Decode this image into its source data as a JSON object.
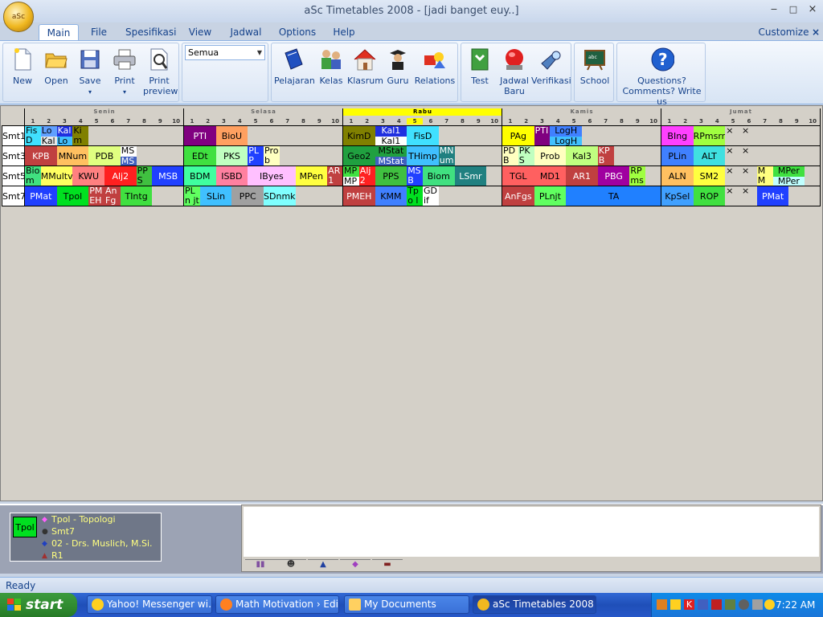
{
  "window": {
    "title": "aSc Timetables 2008  - [jadi banget euy..]",
    "orb_label": "aSc",
    "minimize": "−",
    "maximize": "□",
    "close": "×",
    "customize": "Customize ▾",
    "customize_close": "×"
  },
  "menu_tabs": [
    "Main",
    "File",
    "Spesifikasi",
    "View",
    "Jadwal",
    "Options",
    "Help"
  ],
  "ribbon": {
    "file_buttons": [
      {
        "label": "New",
        "icon": "new-document-icon"
      },
      {
        "label": "Open",
        "icon": "folder-open-icon"
      },
      {
        "label": "Save",
        "icon": "floppy-disk-icon",
        "dropdown": "▾"
      },
      {
        "label": "Print",
        "icon": "printer-icon",
        "dropdown": "▾"
      },
      {
        "label": "Print preview",
        "icon": "print-preview-icon"
      }
    ],
    "filter_select": "Semua",
    "data_buttons": [
      {
        "label": "Pelajaran",
        "icon": "book-icon"
      },
      {
        "label": "Kelas",
        "icon": "students-icon"
      },
      {
        "label": "Klasrum",
        "icon": "house-icon"
      },
      {
        "label": "Guru",
        "icon": "teacher-icon"
      },
      {
        "label": "Relations",
        "icon": "shapes-icon"
      }
    ],
    "gen_buttons": [
      {
        "label": "Test",
        "icon": "test-icon"
      },
      {
        "label": "Jadwal Baru",
        "icon": "generate-icon"
      },
      {
        "label": "Verifikasi",
        "icon": "flashlight-icon"
      }
    ],
    "school_button": {
      "label": "School",
      "icon": "blackboard-icon"
    },
    "help_button": {
      "label": "Questions? Comments? Write us",
      "icon": "question-icon"
    }
  },
  "timetable": {
    "days": [
      "Senin",
      "Selasa",
      "Rabu",
      "Kamis",
      "Jumat"
    ],
    "today": "Rabu",
    "today_period": "5",
    "periods": [
      "1",
      "2",
      "3",
      "4",
      "5",
      "6",
      "7",
      "8",
      "9",
      "10"
    ],
    "rows": [
      "Smt1",
      "Smt3",
      "Smt5",
      "Smt7"
    ],
    "cells": [
      {
        "r": 0,
        "d": 0,
        "p": 0,
        "w": 1,
        "h": 2,
        "t": "Fis D",
        "c": "#40e0ff"
      },
      {
        "r": 0,
        "d": 0,
        "p": 1,
        "w": 1,
        "h": 1,
        "t": "Log",
        "c": "#60a0ff"
      },
      {
        "r": 0,
        "d": 0,
        "p": 1,
        "w": 1,
        "h": 1,
        "o": 1,
        "t": "Kal",
        "c": "#e8e8e8"
      },
      {
        "r": 0,
        "d": 0,
        "p": 2,
        "w": 1,
        "h": 1,
        "t": "Kal",
        "c": "#2030e0"
      },
      {
        "r": 0,
        "d": 0,
        "p": 2,
        "w": 1,
        "h": 1,
        "o": 1,
        "t": "Log",
        "c": "#40c0ff"
      },
      {
        "r": 0,
        "d": 0,
        "p": 3,
        "w": 1,
        "h": 2,
        "t": "Kim D",
        "c": "#808000"
      },
      {
        "r": 0,
        "d": 1,
        "p": 0,
        "w": 2,
        "h": 2,
        "t": "PTI",
        "c": "#800080"
      },
      {
        "r": 0,
        "d": 1,
        "p": 2,
        "w": 2,
        "h": 2,
        "t": "BioU",
        "c": "#ffa060"
      },
      {
        "r": 0,
        "d": 2,
        "p": 0,
        "w": 2,
        "h": 2,
        "t": "KimD",
        "c": "#808000"
      },
      {
        "r": 0,
        "d": 2,
        "p": 2,
        "w": 2,
        "h": 1,
        "t": "Kal1",
        "c": "#2030e0"
      },
      {
        "r": 0,
        "d": 2,
        "p": 2,
        "w": 2,
        "h": 1,
        "o": 1,
        "t": "Kal1",
        "c": "#ffffff"
      },
      {
        "r": 0,
        "d": 2,
        "p": 4,
        "w": 2,
        "h": 2,
        "t": "FisD",
        "c": "#40e0ff"
      },
      {
        "r": 0,
        "d": 3,
        "p": 0,
        "w": 2,
        "h": 2,
        "t": "PAg",
        "c": "#ffff00"
      },
      {
        "r": 0,
        "d": 3,
        "p": 2,
        "w": 1,
        "h": 2,
        "t": "PTI",
        "c": "#800080"
      },
      {
        "r": 0,
        "d": 3,
        "p": 3,
        "w": 2,
        "h": 1,
        "t": "LogH",
        "c": "#4080ff"
      },
      {
        "r": 0,
        "d": 3,
        "p": 3,
        "w": 2,
        "h": 1,
        "o": 1,
        "t": "LogH",
        "c": "#40c0ff"
      },
      {
        "r": 0,
        "d": 4,
        "p": 0,
        "w": 2,
        "h": 2,
        "t": "BIng",
        "c": "#ff40ff"
      },
      {
        "r": 0,
        "d": 4,
        "p": 2,
        "w": 2,
        "h": 2,
        "t": "RPmsrn",
        "c": "#a0ff40"
      },
      {
        "r": 0,
        "d": 4,
        "p": 4,
        "w": 1,
        "h": 2,
        "t": "×",
        "c": "#d4d0c8"
      },
      {
        "r": 0,
        "d": 4,
        "p": 5,
        "w": 1,
        "h": 2,
        "t": "×",
        "c": "#d4d0c8"
      },
      {
        "r": 1,
        "d": 0,
        "p": 0,
        "w": 2,
        "h": 2,
        "t": "KPB",
        "c": "#c04040"
      },
      {
        "r": 1,
        "d": 0,
        "p": 2,
        "w": 2,
        "h": 2,
        "t": "MNum",
        "c": "#ffc060"
      },
      {
        "r": 1,
        "d": 0,
        "p": 4,
        "w": 2,
        "h": 2,
        "t": "PDB",
        "c": "#e0ff80"
      },
      {
        "r": 1,
        "d": 0,
        "p": 6,
        "w": 1,
        "h": 1,
        "t": "MSt",
        "c": "#ffffff"
      },
      {
        "r": 1,
        "d": 0,
        "p": 6,
        "w": 1,
        "h": 1,
        "o": 1,
        "t": "MSt",
        "c": "#4060c0"
      },
      {
        "r": 1,
        "d": 1,
        "p": 0,
        "w": 2,
        "h": 2,
        "t": "EDt",
        "c": "#40e040"
      },
      {
        "r": 1,
        "d": 1,
        "p": 2,
        "w": 2,
        "h": 2,
        "t": "PKS",
        "c": "#c0ffc0"
      },
      {
        "r": 1,
        "d": 1,
        "p": 4,
        "w": 1,
        "h": 2,
        "t": "PL P",
        "c": "#2040ff"
      },
      {
        "r": 1,
        "d": 1,
        "p": 5,
        "w": 1,
        "h": 2,
        "t": "Pro b",
        "c": "#ffffc0"
      },
      {
        "r": 1,
        "d": 2,
        "p": 0,
        "w": 2,
        "h": 2,
        "t": "Geo2",
        "c": "#20a040"
      },
      {
        "r": 1,
        "d": 2,
        "p": 2,
        "w": 2,
        "h": 1,
        "t": "MStat",
        "c": "#20a040"
      },
      {
        "r": 1,
        "d": 2,
        "p": 2,
        "w": 2,
        "h": 1,
        "o": 1,
        "t": "MStat",
        "c": "#4060c0"
      },
      {
        "r": 1,
        "d": 2,
        "p": 4,
        "w": 2,
        "h": 2,
        "t": "THimp",
        "c": "#40c0ff"
      },
      {
        "r": 1,
        "d": 2,
        "p": 6,
        "w": 1,
        "h": 2,
        "t": "MN um",
        "c": "#208080"
      },
      {
        "r": 1,
        "d": 3,
        "p": 0,
        "w": 1,
        "h": 2,
        "t": "PD B",
        "c": "#ffffc0"
      },
      {
        "r": 1,
        "d": 3,
        "p": 1,
        "w": 1,
        "h": 2,
        "t": "PK S",
        "c": "#c0ffc0"
      },
      {
        "r": 1,
        "d": 3,
        "p": 2,
        "w": 2,
        "h": 2,
        "t": "Prob",
        "c": "#ffffc0"
      },
      {
        "r": 1,
        "d": 3,
        "p": 4,
        "w": 2,
        "h": 2,
        "t": "Kal3",
        "c": "#c0ff80"
      },
      {
        "r": 1,
        "d": 3,
        "p": 6,
        "w": 1,
        "h": 2,
        "t": "KP B",
        "c": "#c04040"
      },
      {
        "r": 1,
        "d": 4,
        "p": 0,
        "w": 2,
        "h": 2,
        "t": "PLin",
        "c": "#4080ff"
      },
      {
        "r": 1,
        "d": 4,
        "p": 2,
        "w": 2,
        "h": 2,
        "t": "ALT",
        "c": "#40e0e0"
      },
      {
        "r": 1,
        "d": 4,
        "p": 4,
        "w": 1,
        "h": 2,
        "t": "×",
        "c": "#d4d0c8"
      },
      {
        "r": 1,
        "d": 4,
        "p": 5,
        "w": 1,
        "h": 2,
        "t": "×",
        "c": "#d4d0c8"
      },
      {
        "r": 2,
        "d": 0,
        "p": 0,
        "w": 1,
        "h": 2,
        "t": "Bio m",
        "c": "#40e080"
      },
      {
        "r": 2,
        "d": 0,
        "p": 1,
        "w": 2,
        "h": 2,
        "t": "MMultv",
        "c": "#ffff60"
      },
      {
        "r": 2,
        "d": 0,
        "p": 3,
        "w": 2,
        "h": 2,
        "t": "KWU",
        "c": "#ff8080"
      },
      {
        "r": 2,
        "d": 0,
        "p": 5,
        "w": 2,
        "h": 2,
        "t": "Alj2",
        "c": "#ff2020"
      },
      {
        "r": 2,
        "d": 0,
        "p": 7,
        "w": 1,
        "h": 2,
        "t": "PPS",
        "c": "#40c040"
      },
      {
        "r": 2,
        "d": 0,
        "p": 8,
        "w": 2,
        "h": 2,
        "t": "MSB",
        "c": "#2040ff"
      },
      {
        "r": 2,
        "d": 1,
        "p": 0,
        "w": 2,
        "h": 2,
        "t": "BDM",
        "c": "#40ffa0"
      },
      {
        "r": 2,
        "d": 1,
        "p": 2,
        "w": 2,
        "h": 2,
        "t": "ISBD",
        "c": "#ff80a0"
      },
      {
        "r": 2,
        "d": 1,
        "p": 4,
        "w": 3,
        "h": 2,
        "t": "IByes",
        "c": "#ffc0ff"
      },
      {
        "r": 2,
        "d": 1,
        "p": 7,
        "w": 2,
        "h": 2,
        "t": "MPen",
        "c": "#ffff40"
      },
      {
        "r": 2,
        "d": 1,
        "p": 9,
        "w": 1,
        "h": 2,
        "t": "AR 1",
        "c": "#c04040"
      },
      {
        "r": 2,
        "d": 2,
        "p": 0,
        "w": 1,
        "h": 1,
        "t": "MP",
        "c": "#40e040"
      },
      {
        "r": 2,
        "d": 2,
        "p": 0,
        "w": 1,
        "h": 1,
        "o": 1,
        "t": "MP",
        "c": "#ffffff"
      },
      {
        "r": 2,
        "d": 2,
        "p": 1,
        "w": 1,
        "h": 2,
        "t": "Alj2",
        "c": "#ff2020"
      },
      {
        "r": 2,
        "d": 2,
        "p": 2,
        "w": 2,
        "h": 2,
        "t": "PPS",
        "c": "#40c040"
      },
      {
        "r": 2,
        "d": 2,
        "p": 4,
        "w": 1,
        "h": 2,
        "t": "MS B",
        "c": "#2040ff"
      },
      {
        "r": 2,
        "d": 2,
        "p": 5,
        "w": 2,
        "h": 2,
        "t": "Biom",
        "c": "#40e080"
      },
      {
        "r": 2,
        "d": 2,
        "p": 7,
        "w": 2,
        "h": 2,
        "t": "LSmr",
        "c": "#208080"
      },
      {
        "r": 2,
        "d": 3,
        "p": 0,
        "w": 2,
        "h": 2,
        "t": "TGL",
        "c": "#ff6060"
      },
      {
        "r": 2,
        "d": 3,
        "p": 2,
        "w": 2,
        "h": 2,
        "t": "MD1",
        "c": "#ff6060"
      },
      {
        "r": 2,
        "d": 3,
        "p": 4,
        "w": 2,
        "h": 2,
        "t": "AR1",
        "c": "#c04040"
      },
      {
        "r": 2,
        "d": 3,
        "p": 6,
        "w": 2,
        "h": 2,
        "t": "PBG",
        "c": "#a000a0"
      },
      {
        "r": 2,
        "d": 3,
        "p": 8,
        "w": 1,
        "h": 2,
        "t": "RP msr",
        "c": "#a0ff40"
      },
      {
        "r": 2,
        "d": 4,
        "p": 0,
        "w": 2,
        "h": 2,
        "t": "ALN",
        "c": "#ffc060"
      },
      {
        "r": 2,
        "d": 4,
        "p": 2,
        "w": 2,
        "h": 2,
        "t": "SM2",
        "c": "#ffff40"
      },
      {
        "r": 2,
        "d": 4,
        "p": 4,
        "w": 1,
        "h": 2,
        "t": "×",
        "c": "#d4d0c8"
      },
      {
        "r": 2,
        "d": 4,
        "p": 5,
        "w": 1,
        "h": 2,
        "t": "×",
        "c": "#d4d0c8"
      },
      {
        "r": 2,
        "d": 4,
        "p": 6,
        "w": 1,
        "h": 2,
        "t": "MM ultv",
        "c": "#ffff80"
      },
      {
        "r": 2,
        "d": 4,
        "p": 7,
        "w": 2,
        "h": 1,
        "t": "MPer",
        "c": "#40e040"
      },
      {
        "r": 2,
        "d": 4,
        "p": 7,
        "w": 2,
        "h": 1,
        "o": 1,
        "t": "MPer",
        "c": "#c0ffff"
      },
      {
        "r": 3,
        "d": 0,
        "p": 0,
        "w": 2,
        "h": 2,
        "t": "PMat",
        "c": "#2040ff"
      },
      {
        "r": 3,
        "d": 0,
        "p": 2,
        "w": 2,
        "h": 2,
        "t": "Tpol",
        "c": "#00e020"
      },
      {
        "r": 3,
        "d": 0,
        "p": 4,
        "w": 1,
        "h": 2,
        "t": "PM EH",
        "c": "#c04040"
      },
      {
        "r": 3,
        "d": 0,
        "p": 5,
        "w": 1,
        "h": 2,
        "t": "AnFgs",
        "c": "#c04040"
      },
      {
        "r": 3,
        "d": 0,
        "p": 6,
        "w": 2,
        "h": 2,
        "t": "TIntg",
        "c": "#40e040"
      },
      {
        "r": 3,
        "d": 1,
        "p": 0,
        "w": 1,
        "h": 2,
        "t": "PLn jt",
        "c": "#60ff60"
      },
      {
        "r": 3,
        "d": 1,
        "p": 1,
        "w": 2,
        "h": 2,
        "t": "SLin",
        "c": "#40c0ff"
      },
      {
        "r": 3,
        "d": 1,
        "p": 3,
        "w": 2,
        "h": 2,
        "t": "PPC",
        "c": "#a0a0a0"
      },
      {
        "r": 3,
        "d": 1,
        "p": 5,
        "w": 2,
        "h": 2,
        "t": "SDnmk",
        "c": "#80ffff"
      },
      {
        "r": 3,
        "d": 2,
        "p": 0,
        "w": 2,
        "h": 2,
        "t": "PMEH",
        "c": "#c04040"
      },
      {
        "r": 3,
        "d": 2,
        "p": 2,
        "w": 2,
        "h": 2,
        "t": "KMM",
        "c": "#4080ff"
      },
      {
        "r": 3,
        "d": 2,
        "p": 4,
        "w": 1,
        "h": 2,
        "t": "Tpo l",
        "c": "#00e020"
      },
      {
        "r": 3,
        "d": 2,
        "p": 5,
        "w": 1,
        "h": 2,
        "t": "GDif",
        "c": "#ffffff"
      },
      {
        "r": 3,
        "d": 3,
        "p": 0,
        "w": 2,
        "h": 2,
        "t": "AnFgs",
        "c": "#c04040"
      },
      {
        "r": 3,
        "d": 3,
        "p": 2,
        "w": 2,
        "h": 2,
        "t": "PLnjt",
        "c": "#60ff60"
      },
      {
        "r": 3,
        "d": 3,
        "p": 4,
        "w": 6,
        "h": 2,
        "t": "TA",
        "c": "#2080ff"
      },
      {
        "r": 3,
        "d": 4,
        "p": 0,
        "w": 2,
        "h": 2,
        "t": "KpSel",
        "c": "#40a0ff"
      },
      {
        "r": 3,
        "d": 4,
        "p": 2,
        "w": 2,
        "h": 2,
        "t": "ROP",
        "c": "#40e040"
      },
      {
        "r": 3,
        "d": 4,
        "p": 4,
        "w": 1,
        "h": 2,
        "t": "×",
        "c": "#d4d0c8"
      },
      {
        "r": 3,
        "d": 4,
        "p": 5,
        "w": 1,
        "h": 2,
        "t": "×",
        "c": "#d4d0c8"
      },
      {
        "r": 3,
        "d": 4,
        "p": 6,
        "w": 2,
        "h": 2,
        "t": "PMat",
        "c": "#2040ff"
      }
    ]
  },
  "info": {
    "short": "Tpol",
    "lines": [
      {
        "icon": "subject-icon",
        "text": "Tpol - Topologi"
      },
      {
        "icon": "class-icon",
        "text": "Smt7"
      },
      {
        "icon": "teacher-icon",
        "text": "02 - Drs. Muslich, M.Si."
      },
      {
        "icon": "classroom-icon",
        "text": "R1"
      }
    ]
  },
  "bottom_tabs": [
    "tab-icon-1",
    "tab-icon-2",
    "tab-icon-3",
    "tab-icon-4",
    "tab-icon-5"
  ],
  "status": "Ready",
  "taskbar": {
    "start": "start",
    "tasks": [
      {
        "label": "Yahoo! Messenger wi...",
        "color": "#ffd020"
      },
      {
        "label": "Math Motivation › Edi...",
        "color": "#ff8020"
      },
      {
        "label": "My Documents",
        "color": "#ffd060"
      },
      {
        "label": "aSc Timetables 2008  ...",
        "color": "#f0b820"
      }
    ],
    "clock": "7:22 AM"
  }
}
